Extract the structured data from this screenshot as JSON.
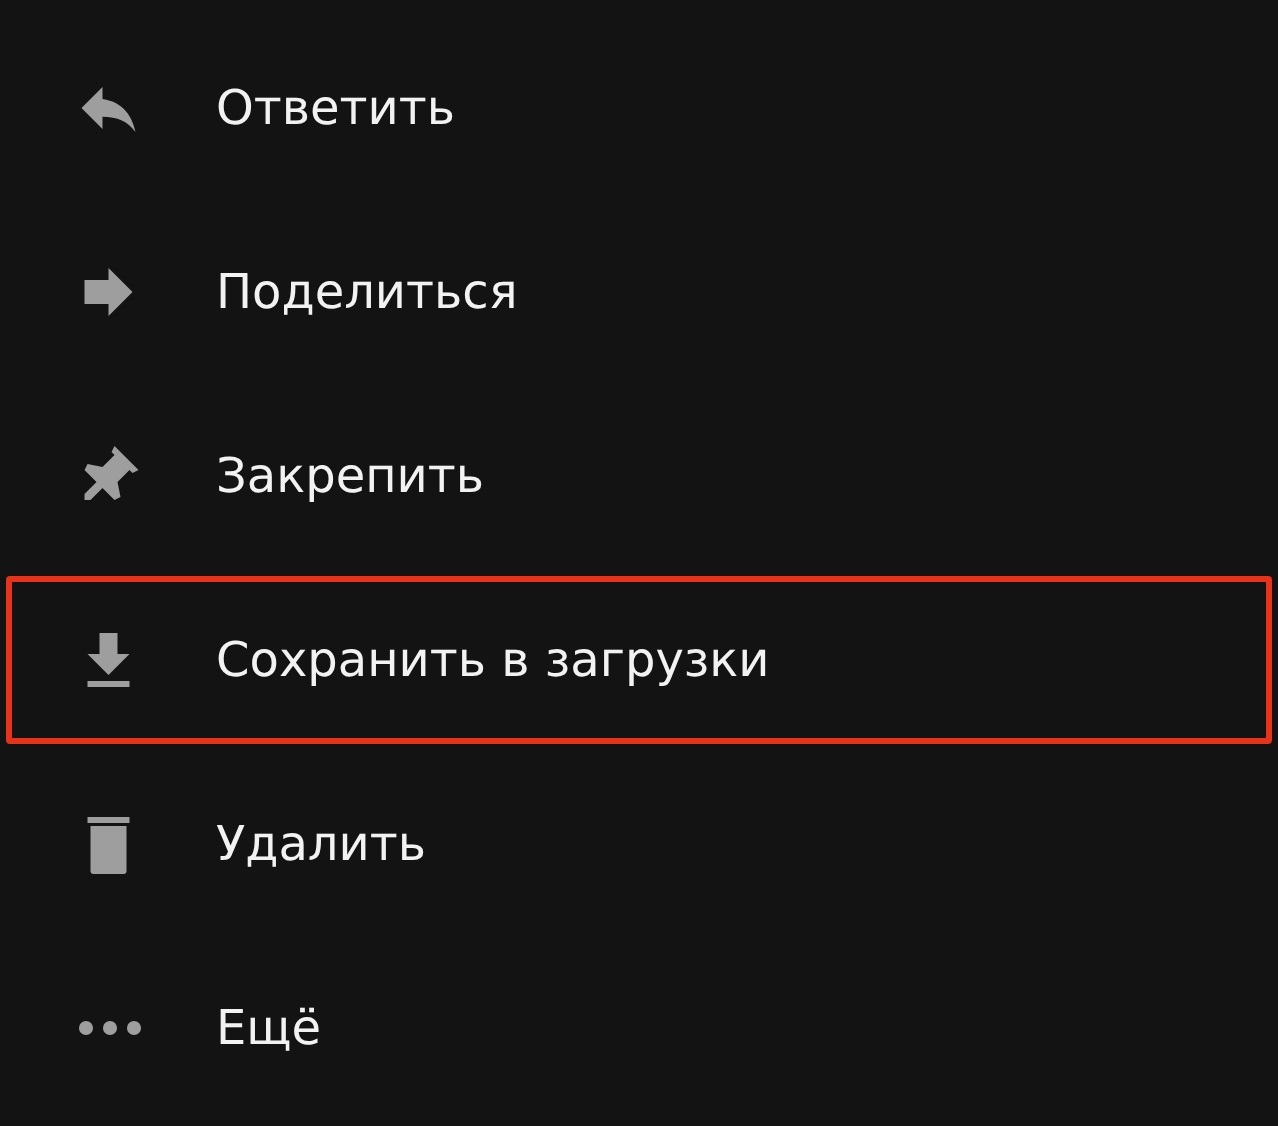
{
  "menu": {
    "items": [
      {
        "label": "Ответить",
        "selected": false
      },
      {
        "label": "Поделиться",
        "selected": false
      },
      {
        "label": "Закрепить",
        "selected": false
      },
      {
        "label": "Сохранить в загрузки",
        "selected": true
      },
      {
        "label": "Удалить",
        "selected": false
      },
      {
        "label": "Ещё",
        "selected": false
      }
    ]
  }
}
